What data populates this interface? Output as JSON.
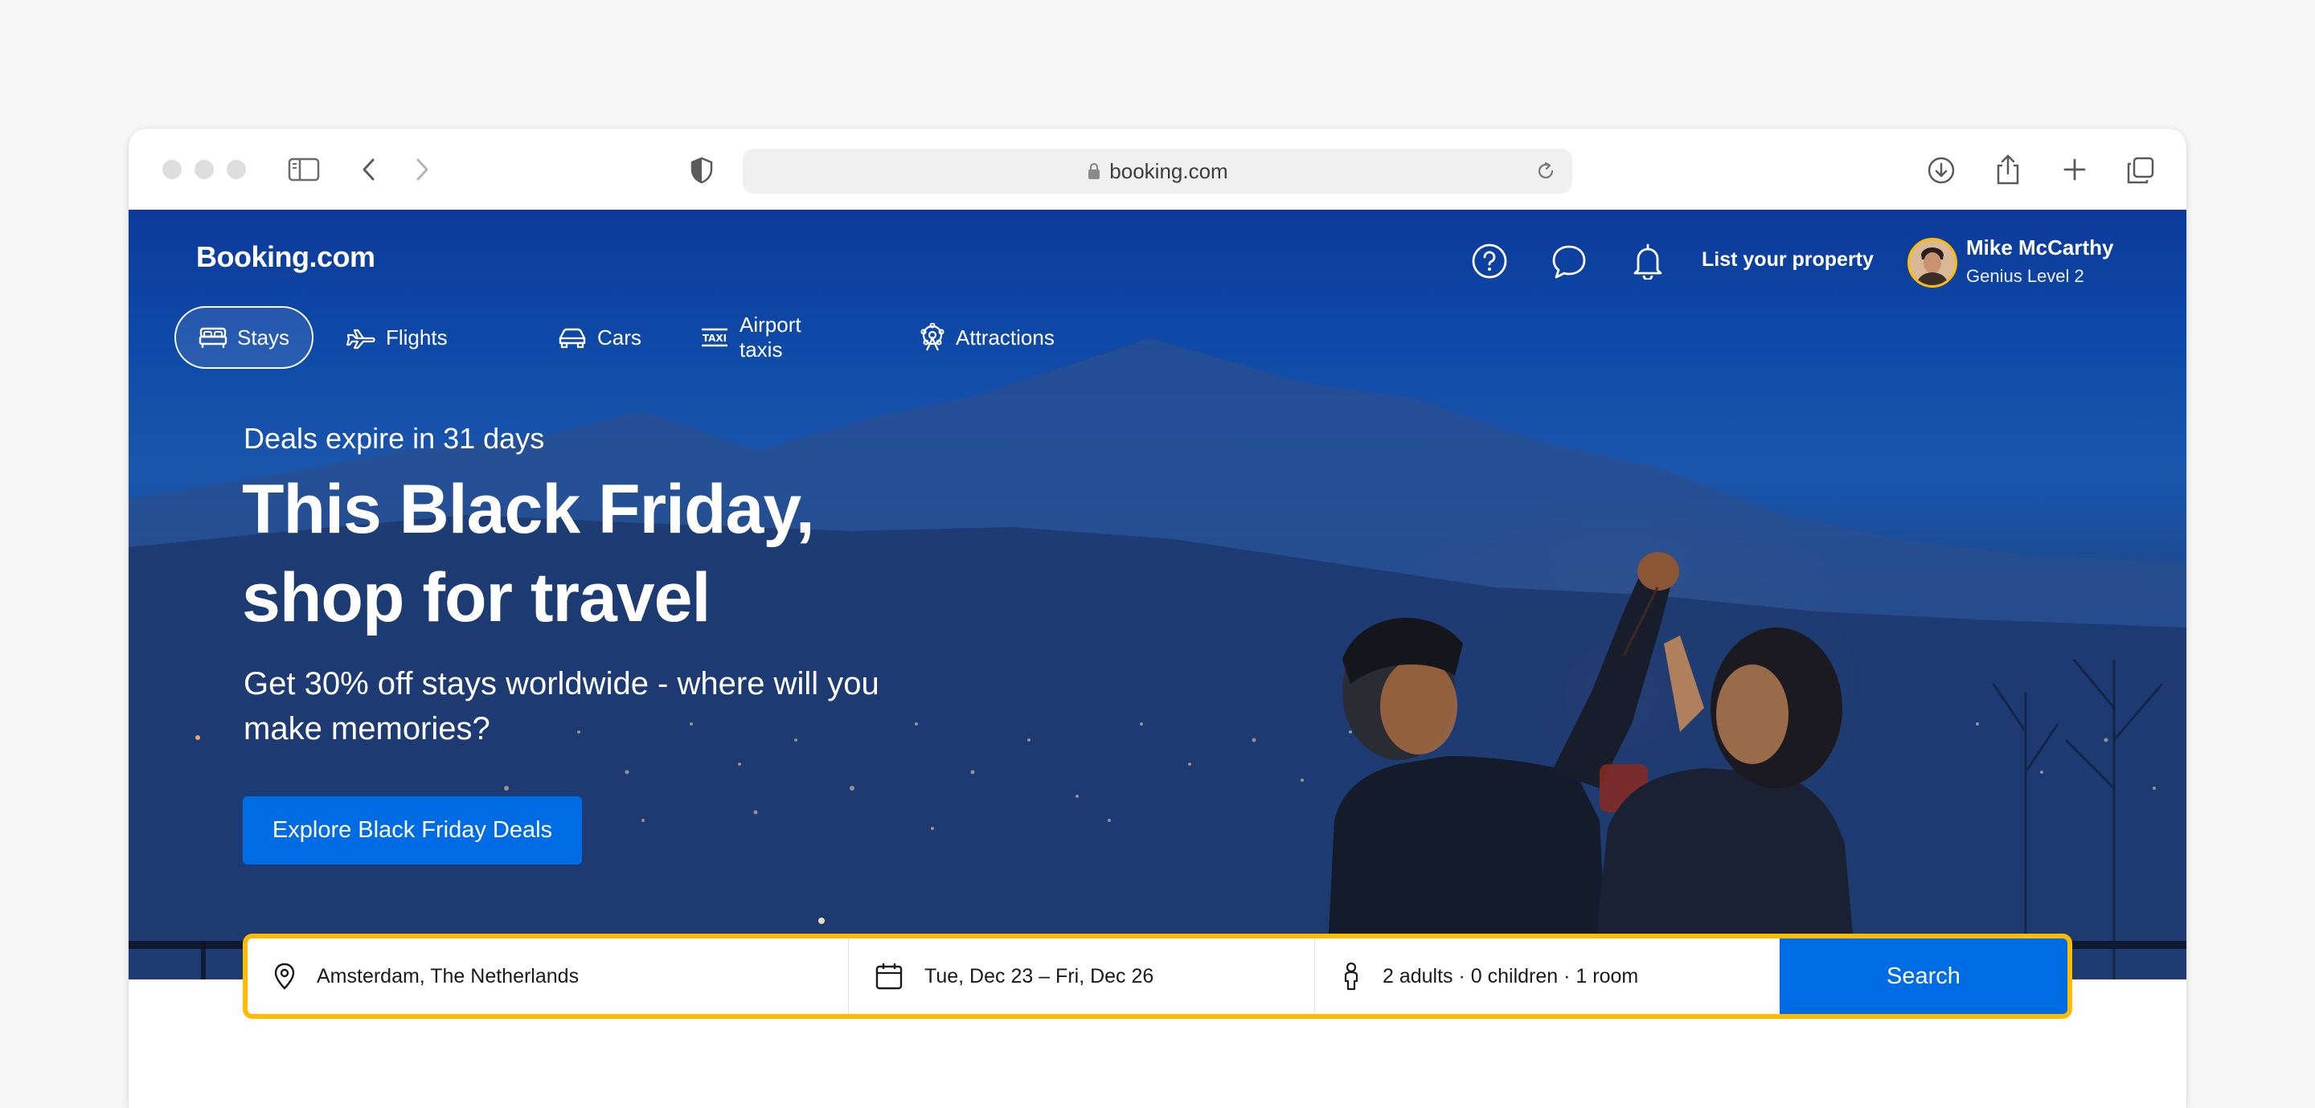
{
  "browser": {
    "url": "booking.com"
  },
  "site": {
    "logo": "Booking.com",
    "list_property": "List your property",
    "user": {
      "name": "Mike McCarthy",
      "level": "Genius Level 2"
    }
  },
  "nav": {
    "items": [
      {
        "label": "Stays",
        "icon": "bed-icon",
        "active": true
      },
      {
        "label": "Flights",
        "icon": "plane-icon"
      },
      {
        "label": "Cars",
        "icon": "car-icon"
      },
      {
        "label": "Airport taxis",
        "icon": "taxi-icon"
      },
      {
        "label": "Attractions",
        "icon": "attractions-icon"
      }
    ]
  },
  "hero": {
    "deals_expire": "Deals expire in 31 days",
    "headline_line1": "This Black Friday,",
    "headline_line2": "shop for travel",
    "subline": "Get 30% off stays worldwide - where will you make memories?",
    "cta": "Explore Black Friday Deals"
  },
  "search": {
    "destination": "Amsterdam, The Netherlands",
    "dates": "Tue, Dec 23 – Fri, Dec 26",
    "guests": "2 adults · 0 children · 1 room",
    "button": "Search"
  },
  "colors": {
    "brand_blue": "#003b95",
    "accent_blue": "#006ce4",
    "search_border": "#febb02"
  }
}
